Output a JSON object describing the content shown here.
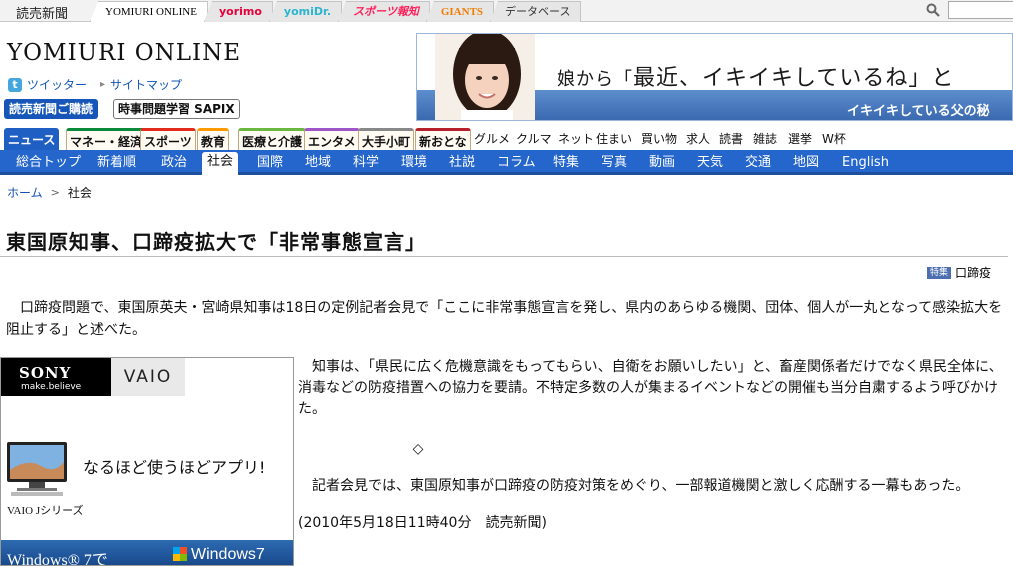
{
  "site_bar": {
    "brand": "読売新聞",
    "tabs": [
      "YOMIURI ONLINE",
      "yorimo",
      "yomiDr.",
      "スポーツ報知",
      "GIANTS",
      "データベース"
    ],
    "search_icon": "search-icon"
  },
  "header": {
    "logo": "YOMIURI ONLINE",
    "twitter": "ツイッター",
    "sitemap": "サイトマップ",
    "subscribe": "読売新聞ご購読",
    "sapix": "時事問題学習 SAPIX"
  },
  "banner": {
    "line1_a": "娘から「",
    "line1_b": "最近、イキイキしているね",
    "line1_c": "」と",
    "line2": "イキイキしている父の秘"
  },
  "category_tabs": [
    "ニュース",
    "マネー・経済",
    "スポーツ",
    "教育",
    "医療と介護",
    "エンタメ",
    "大手小町",
    "新おとな"
  ],
  "category_links": [
    "グルメ",
    "クルマ",
    "ネット",
    "住まい",
    "買い物",
    "求人",
    "読書",
    "雑誌",
    "選挙",
    "W杯"
  ],
  "sub_nav": [
    "総合トップ",
    "新着順",
    "政治",
    "社会",
    "国際",
    "地域",
    "科学",
    "環境",
    "社説",
    "コラム",
    "特集",
    "写真",
    "動画",
    "天気",
    "交通",
    "地図",
    "English"
  ],
  "breadcrumb": {
    "home": "ホーム",
    "current": "社会"
  },
  "article": {
    "title": "東国原知事、口蹄疫拡大で「非常事態宣言」",
    "tag_label": "特集",
    "tag_link": "口蹄疫",
    "para1": "口蹄疫問題で、東国原英夫・宮崎県知事は18日の定例記者会見で「ここに非常事態宣言を発し、県内のあらゆる機関、団体、個人が一丸となって感染拡大を阻止する」と述べた。",
    "para2": "知事は、「県民に広く危機意識をもってもらい、自衛をお願いしたい」と、畜産関係者だけでなく県民全体に、消毒などの防疫措置への協力を要請。不特定多数の人が集まるイベントなどの開催も当分自粛するよう呼びかけた。",
    "separator": "◇",
    "para3": "記者会見では、東国原知事が口蹄疫の防疫対策をめぐり、一部報道機関と激しく応酬する一幕もあった。",
    "dateline": "(2010年5月18日11時40分　読売新聞)"
  },
  "vaio_ad": {
    "brand": "SONY",
    "tagline": "make.believe",
    "vaio": "VAIO",
    "catch": "なるほど使うほどアプリ!",
    "model": "VAIO Jシリーズ",
    "windows_a": "Windows® 7で",
    "windows_b": "Windows7"
  }
}
